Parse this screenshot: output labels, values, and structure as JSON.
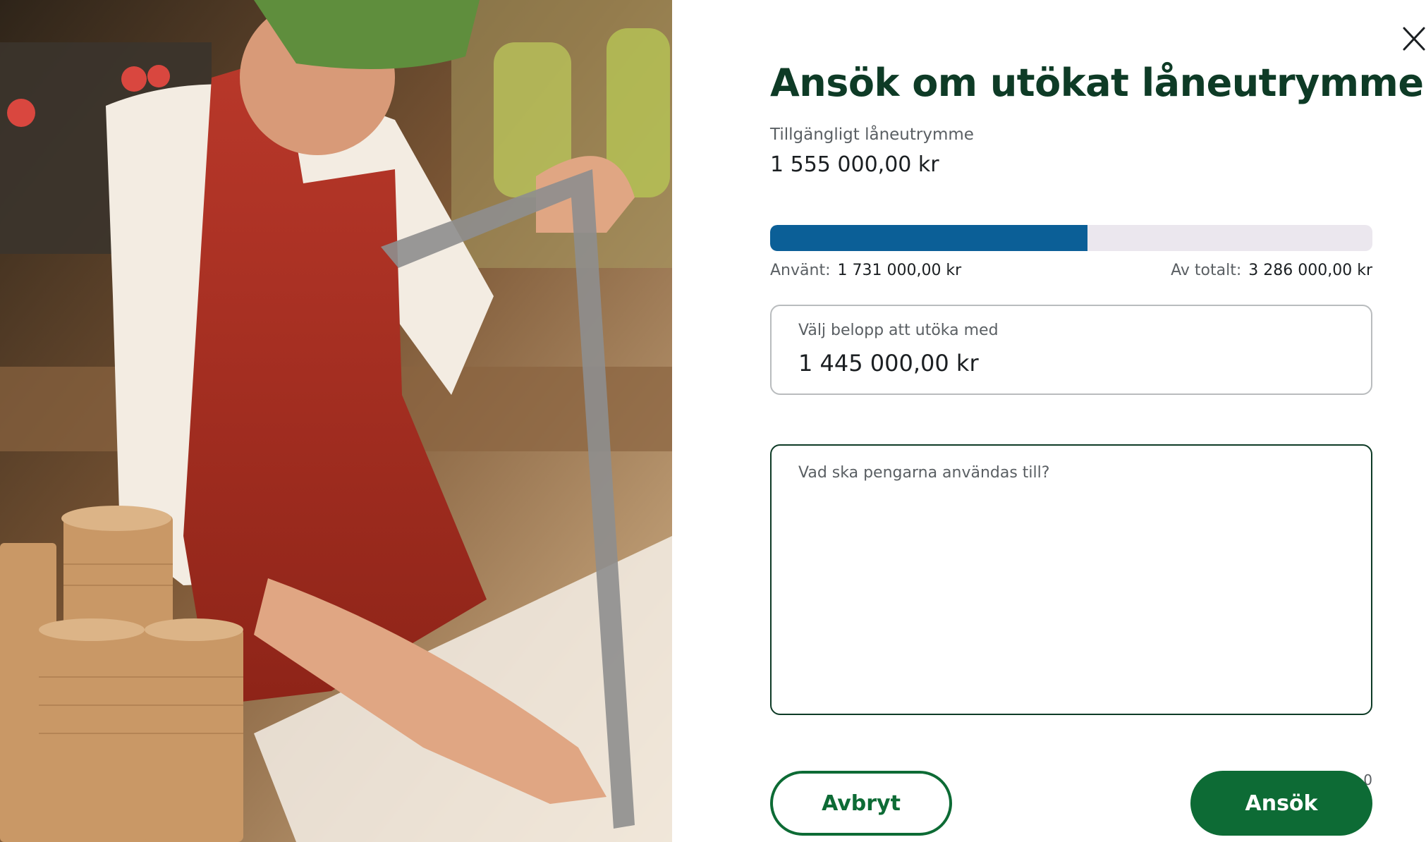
{
  "dialog": {
    "title": "Ansök om utökat låneutrymme",
    "available_label": "Tillgängligt låneutrymme",
    "available_value": "1 555 000,00 kr",
    "usage": {
      "used_label": "Använt:",
      "used_value": "1 731 000,00 kr",
      "total_label": "Av totalt:",
      "total_value": "3 286 000,00 kr",
      "used_fraction": 0.527
    },
    "amount_field": {
      "label": "Välj belopp att utöka med",
      "value": "1 445 000,00 kr"
    },
    "purpose_field": {
      "placeholder": "Vad ska pengarna användas till?",
      "value": "",
      "counter": "0"
    },
    "buttons": {
      "cancel_label": "Avbryt",
      "apply_label": "Ansök"
    }
  },
  "icons": {
    "close": "close-icon"
  },
  "colors": {
    "title": "#0e3b26",
    "primary_green": "#0d6b35",
    "progress_fill": "#0b5f97",
    "progress_track": "#ebe7ee"
  }
}
